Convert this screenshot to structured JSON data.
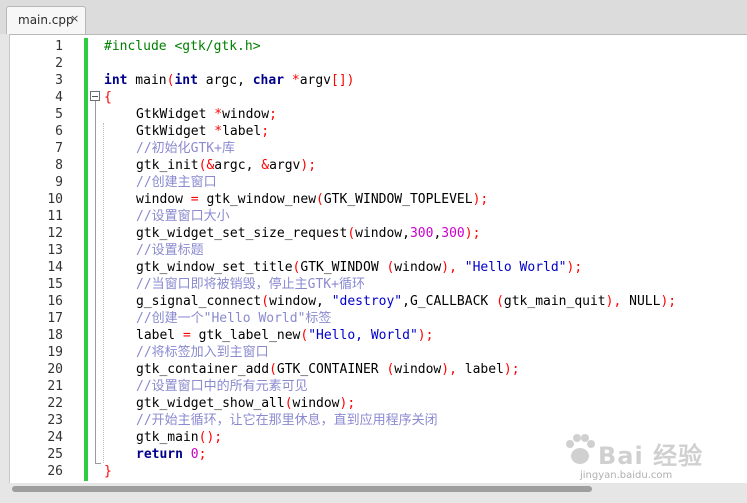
{
  "tab": {
    "label": "main.cpp",
    "close_glyph": "×"
  },
  "line_numbers": [
    "1",
    "2",
    "3",
    "4",
    "5",
    "6",
    "7",
    "8",
    "9",
    "10",
    "11",
    "12",
    "13",
    "14",
    "15",
    "16",
    "17",
    "18",
    "19",
    "20",
    "21",
    "22",
    "23",
    "24",
    "25",
    "26"
  ],
  "code_lines": [
    [
      {
        "t": "#include <gtk/gtk.h>",
        "c": "pp"
      }
    ],
    [],
    [
      {
        "t": "int",
        "c": "kw"
      },
      {
        "t": " main"
      },
      {
        "t": "(",
        "c": "op"
      },
      {
        "t": "int",
        "c": "kw"
      },
      {
        "t": " argc, "
      },
      {
        "t": "char",
        "c": "kw"
      },
      {
        "t": " "
      },
      {
        "t": "*",
        "c": "op"
      },
      {
        "t": "argv"
      },
      {
        "t": "[])",
        "c": "op"
      }
    ],
    [
      {
        "t": "{",
        "c": "op"
      }
    ],
    [
      {
        "t": "GtkWidget "
      },
      {
        "t": "*",
        "c": "op"
      },
      {
        "t": "window"
      },
      {
        "t": ";",
        "c": "op"
      }
    ],
    [
      {
        "t": "GtkWidget "
      },
      {
        "t": "*",
        "c": "op"
      },
      {
        "t": "label"
      },
      {
        "t": ";",
        "c": "op"
      }
    ],
    [
      {
        "t": "//初始化GTK+库",
        "c": "cm"
      }
    ],
    [
      {
        "t": "gtk_init"
      },
      {
        "t": "(&",
        "c": "op"
      },
      {
        "t": "argc, "
      },
      {
        "t": "&",
        "c": "op"
      },
      {
        "t": "argv"
      },
      {
        "t": ");",
        "c": "op"
      }
    ],
    [
      {
        "t": "//创建主窗口",
        "c": "cm"
      }
    ],
    [
      {
        "t": "window "
      },
      {
        "t": "=",
        "c": "op"
      },
      {
        "t": " gtk_window_new"
      },
      {
        "t": "(",
        "c": "op"
      },
      {
        "t": "GTK_WINDOW_TOPLEVEL"
      },
      {
        "t": ");",
        "c": "op"
      }
    ],
    [
      {
        "t": "//设置窗口大小",
        "c": "cm"
      }
    ],
    [
      {
        "t": "gtk_widget_set_size_request"
      },
      {
        "t": "(",
        "c": "op"
      },
      {
        "t": "window,"
      },
      {
        "t": "300",
        "c": "num"
      },
      {
        "t": ","
      },
      {
        "t": "300",
        "c": "num"
      },
      {
        "t": ");",
        "c": "op"
      }
    ],
    [
      {
        "t": "//设置标题",
        "c": "cm"
      }
    ],
    [
      {
        "t": "gtk_window_set_title"
      },
      {
        "t": "(",
        "c": "op"
      },
      {
        "t": "GTK_WINDOW "
      },
      {
        "t": "(",
        "c": "op"
      },
      {
        "t": "window"
      },
      {
        "t": "),",
        "c": "op"
      },
      {
        "t": " "
      },
      {
        "t": "\"Hello World\"",
        "c": "str"
      },
      {
        "t": ");",
        "c": "op"
      }
    ],
    [
      {
        "t": "//当窗口即将被销毁，停止主GTK+循环",
        "c": "cm"
      }
    ],
    [
      {
        "t": "g_signal_connect"
      },
      {
        "t": "(",
        "c": "op"
      },
      {
        "t": "window, "
      },
      {
        "t": "\"destroy\"",
        "c": "str"
      },
      {
        "t": ",G_CALLBACK "
      },
      {
        "t": "(",
        "c": "op"
      },
      {
        "t": "gtk_main_quit"
      },
      {
        "t": "),",
        "c": "op"
      },
      {
        "t": " NULL"
      },
      {
        "t": ");",
        "c": "op"
      }
    ],
    [
      {
        "t": "//创建一个\"Hello World\"标签",
        "c": "cm"
      }
    ],
    [
      {
        "t": "label "
      },
      {
        "t": "=",
        "c": "op"
      },
      {
        "t": " gtk_label_new"
      },
      {
        "t": "(",
        "c": "op"
      },
      {
        "t": "\"Hello, World\"",
        "c": "str"
      },
      {
        "t": ");",
        "c": "op"
      }
    ],
    [
      {
        "t": "//将标签加入到主窗口",
        "c": "cm"
      }
    ],
    [
      {
        "t": "gtk_container_add"
      },
      {
        "t": "(",
        "c": "op"
      },
      {
        "t": "GTK_CONTAINER "
      },
      {
        "t": "(",
        "c": "op"
      },
      {
        "t": "window"
      },
      {
        "t": "),",
        "c": "op"
      },
      {
        "t": " label"
      },
      {
        "t": ");",
        "c": "op"
      }
    ],
    [
      {
        "t": "//设置窗口中的所有元素可见",
        "c": "cm"
      }
    ],
    [
      {
        "t": "gtk_widget_show_all"
      },
      {
        "t": "(",
        "c": "op"
      },
      {
        "t": "window"
      },
      {
        "t": ");",
        "c": "op"
      }
    ],
    [
      {
        "t": "//开始主循环，让它在那里休息，直到应用程序关闭",
        "c": "cm"
      }
    ],
    [
      {
        "t": "gtk_main"
      },
      {
        "t": "();",
        "c": "op"
      }
    ],
    [
      {
        "t": "return",
        "c": "kw"
      },
      {
        "t": " "
      },
      {
        "t": "0",
        "c": "num"
      },
      {
        "t": ";",
        "c": "op"
      }
    ],
    [
      {
        "t": "}",
        "c": "op"
      }
    ]
  ],
  "indented_lines": [
    5,
    6,
    7,
    8,
    9,
    10,
    11,
    12,
    13,
    14,
    15,
    16,
    17,
    18,
    19,
    20,
    21,
    22,
    23,
    24,
    25
  ],
  "watermark": {
    "text": "Bai 经验",
    "url": "jingyan.baidu.com"
  },
  "colors": {
    "keyword": "#00008b",
    "preprocessor": "#008000",
    "operator": "#ff0000",
    "string": "#0000cc",
    "number": "#cc00cc",
    "comment": "#8a8ad0",
    "change_bar": "#2ecc40"
  },
  "icons": {
    "tab_close": "close-icon",
    "fold_marker": "fold-collapse-icon"
  }
}
